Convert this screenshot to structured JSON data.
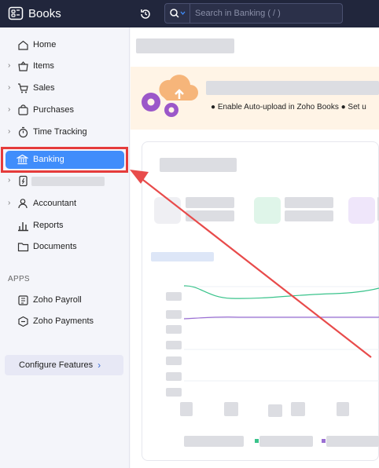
{
  "app": {
    "name": "Books"
  },
  "search": {
    "placeholder": "Search in Banking ( / )"
  },
  "sidebar": {
    "items": [
      {
        "label": "Home"
      },
      {
        "label": "Items"
      },
      {
        "label": "Sales"
      },
      {
        "label": "Purchases"
      },
      {
        "label": "Time Tracking"
      },
      {
        "label": "Banking"
      },
      {
        "label": ""
      },
      {
        "label": "Accountant"
      },
      {
        "label": "Reports"
      },
      {
        "label": "Documents"
      }
    ],
    "apps_title": "APPS",
    "apps": [
      {
        "label": "Zoho Payroll"
      },
      {
        "label": "Zoho Payments"
      }
    ],
    "configure_label": "Configure Features",
    "configure_arrow": "›"
  },
  "banner": {
    "text": "● Enable Auto-upload in Zoho Books   ● Set u"
  },
  "colors": {
    "topbar": "#21263c",
    "accent": "#408dfb",
    "highlight": "#e53b3b",
    "banner_bg": "#fff4e6",
    "series_green": "#39c38b",
    "series_purple": "#9b6fd3"
  }
}
